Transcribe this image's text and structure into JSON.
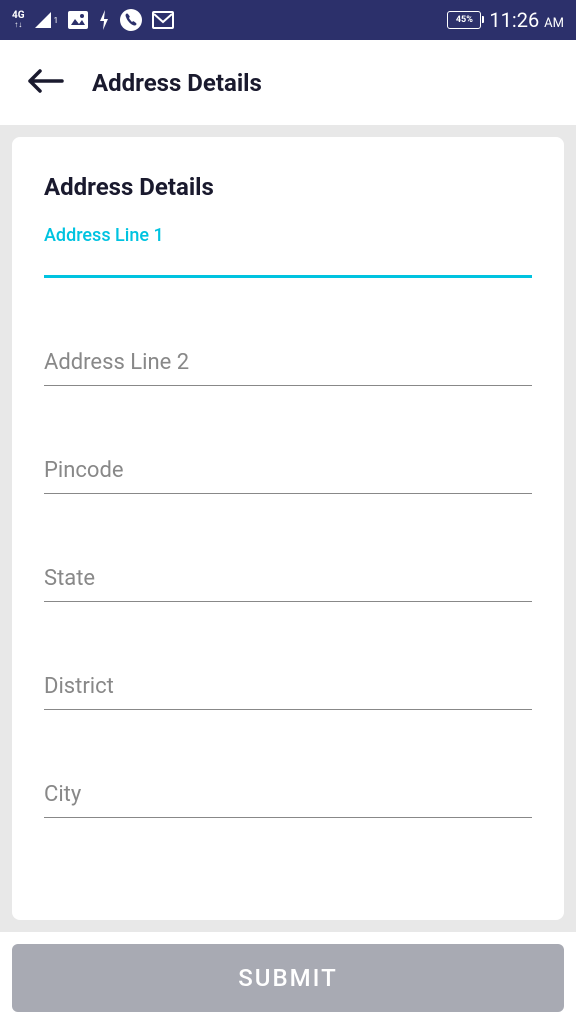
{
  "status": {
    "network": "4G",
    "battery": "45%",
    "time": "11:26",
    "ampm": "AM"
  },
  "header": {
    "title": "Address Details"
  },
  "form": {
    "section_title": "Address Details",
    "fields": {
      "address1": {
        "label": "Address Line 1",
        "value": ""
      },
      "address2": {
        "placeholder": "Address Line 2",
        "value": ""
      },
      "pincode": {
        "placeholder": "Pincode",
        "value": ""
      },
      "state": {
        "placeholder": "State",
        "value": ""
      },
      "district": {
        "placeholder": "District",
        "value": ""
      },
      "city": {
        "placeholder": "City",
        "value": ""
      }
    },
    "submit_label": "SUBMIT"
  }
}
